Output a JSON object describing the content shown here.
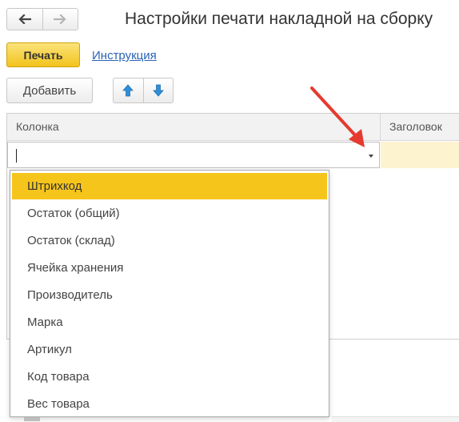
{
  "window": {
    "title": "Настройки печати накладной на сборку"
  },
  "nav": {
    "back_icon": "arrow-left-icon",
    "forward_icon": "arrow-right-icon"
  },
  "toolbar": {
    "print_label": "Печать",
    "instruction_label": "Инструкция"
  },
  "table_toolbar": {
    "add_label": "Добавить",
    "move_up_icon": "arrow-up-icon",
    "move_down_icon": "arrow-down-icon"
  },
  "table": {
    "columns": [
      "Колонка",
      "Заголовок"
    ],
    "edit_value": ""
  },
  "dropdown": {
    "selected_index": 0,
    "items": [
      "Штрихкод",
      "Остаток (общий)",
      "Остаток (склад)",
      "Ячейка хранения",
      "Производитель",
      "Марка",
      "Артикул",
      "Код товара",
      "Вес товара"
    ]
  },
  "colors": {
    "accent_yellow": "#f6c51c",
    "link_blue": "#2a63b5",
    "arrow_blue": "#2f8fd8",
    "annotation_red": "#e53a2f"
  }
}
